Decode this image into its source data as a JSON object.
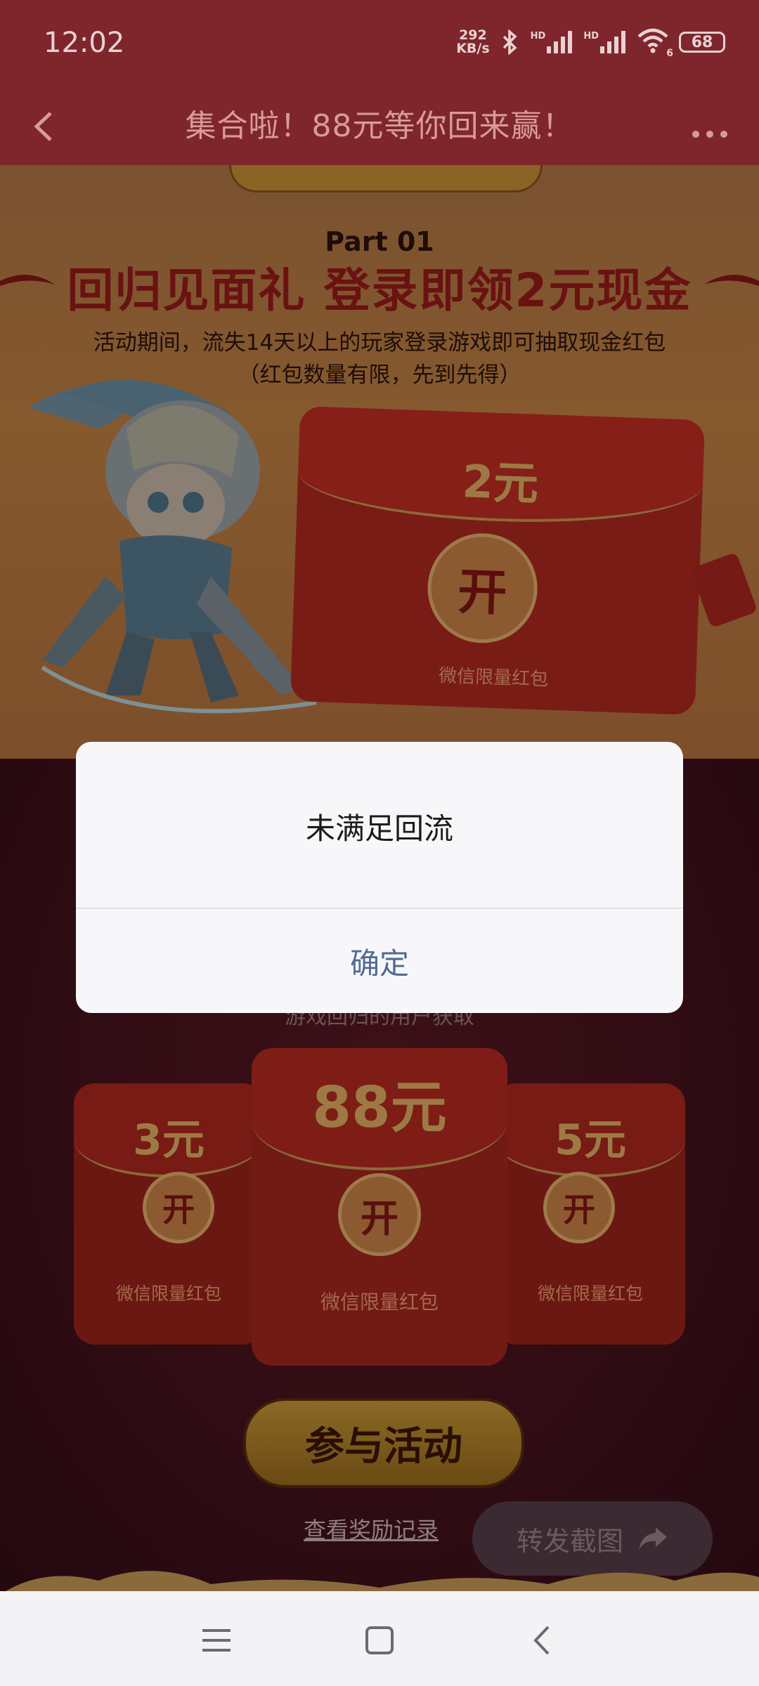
{
  "status": {
    "time": "12:02",
    "net_speed_value": "292",
    "net_speed_unit": "KB/s",
    "network_label_1": "HD",
    "network_label_2": "HD",
    "wifi_label": "6",
    "battery": "68"
  },
  "titlebar": {
    "title": "集合啦！88元等你回来赢！",
    "back_icon": "chevron-left-icon",
    "more_icon": "more-horizontal-icon"
  },
  "event": {
    "part": "Part 01",
    "title": "回归见面礼 登录即领2元现金",
    "desc_line1": "活动期间，流失14天以上的玩家登录游戏即可抽取现金红包",
    "desc_line2": "（红包数量有限，先到先得）",
    "main_envelope": {
      "amount": "2元",
      "open": "开",
      "caption": "微信限量红包"
    }
  },
  "envelopes": [
    {
      "amount": "3元",
      "open": "开",
      "caption": "微信限量红包"
    },
    {
      "amount": "88元",
      "open": "开",
      "caption": "微信限量红包"
    },
    {
      "amount": "5元",
      "open": "开",
      "caption": "微信限量红包"
    }
  ],
  "partial_text": "游戏回归的用户获取",
  "actions": {
    "join": "参与活动",
    "records": "查看奖励记录",
    "share": "转发截图"
  },
  "dialog": {
    "message": "未满足回流",
    "confirm": "确定"
  },
  "colors": {
    "titlebar": "#7e262c",
    "dialog_bg": "#f7f7fa",
    "confirm_text": "#4f6b93"
  }
}
